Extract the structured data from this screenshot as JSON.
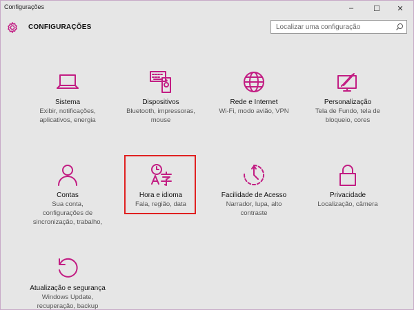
{
  "window": {
    "title": "Configurações",
    "controls": {
      "minimize": "–",
      "maximize": "☐",
      "close": "✕"
    }
  },
  "header": {
    "heading": "CONFIGURAÇÕES",
    "search_placeholder": "Localizar uma configuração"
  },
  "accent_color": "#c21d83",
  "tiles": [
    {
      "id": "sistema",
      "icon": "laptop-icon",
      "name": "Sistema",
      "desc": [
        "Exibir, notificações,",
        "aplicativos, energia"
      ]
    },
    {
      "id": "dispositivos",
      "icon": "devices-icon",
      "name": "Dispositivos",
      "desc": [
        "Bluetooth, impressoras,",
        "mouse"
      ]
    },
    {
      "id": "rede",
      "icon": "globe-icon",
      "name": "Rede e Internet",
      "desc": [
        "Wi-Fi, modo avião, VPN"
      ]
    },
    {
      "id": "personalizacao",
      "icon": "personalization-icon",
      "name": "Personalização",
      "desc": [
        "Tela de Fundo, tela de",
        "bloqueio, cores"
      ]
    },
    {
      "id": "contas",
      "icon": "person-icon",
      "name": "Contas",
      "desc": [
        "Sua conta,",
        "configurações de",
        "sincronização, trabalho,"
      ]
    },
    {
      "id": "hora",
      "icon": "time-language-icon",
      "name": "Hora e idioma",
      "desc": [
        "Fala, região, data"
      ],
      "selected": true
    },
    {
      "id": "facilidade",
      "icon": "ease-of-access-icon",
      "name": "Facilidade de Acesso",
      "desc": [
        "Narrador, lupa, alto",
        "contraste"
      ]
    },
    {
      "id": "privacidade",
      "icon": "lock-icon",
      "name": "Privacidade",
      "desc": [
        "Localização, câmera"
      ]
    },
    {
      "id": "atualizacao",
      "icon": "update-icon",
      "name": "Atualização e segurança",
      "desc": [
        "Windows Update,",
        "recuperação, backup"
      ]
    }
  ]
}
